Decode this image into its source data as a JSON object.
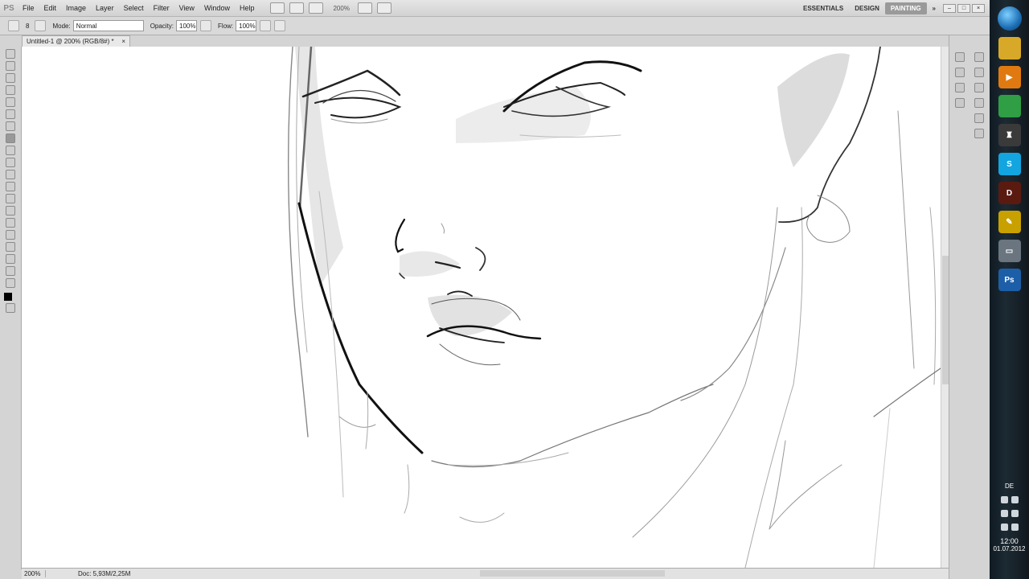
{
  "menubar": {
    "logo": "PS",
    "items": [
      "File",
      "Edit",
      "Image",
      "Layer",
      "Select",
      "Filter",
      "View",
      "Window",
      "Help"
    ],
    "zoom": "200%",
    "workspaces": [
      "ESSENTIALS",
      "DESIGN",
      "PAINTING"
    ],
    "active_workspace": "PAINTING",
    "more": "»"
  },
  "options": {
    "brush_size": "8",
    "mode_label": "Mode:",
    "mode_value": "Normal",
    "opacity_label": "Opacity:",
    "opacity_value": "100%",
    "flow_label": "Flow:",
    "flow_value": "100%"
  },
  "document": {
    "tab_title": "Untitled-1 @ 200% (RGB/8#) *",
    "close": "×"
  },
  "status": {
    "zoom": "200%",
    "doc_info": "Doc: 5,93M/2,25M"
  },
  "taskbar": {
    "language": "DE",
    "time": "12:00",
    "date": "01.07.2012",
    "apps": [
      {
        "name": "explorer",
        "label": "",
        "color": "#d8a928"
      },
      {
        "name": "media-player",
        "label": "▶",
        "color": "#e07a10"
      },
      {
        "name": "chrome",
        "label": "",
        "color": "#2f9e44"
      },
      {
        "name": "world-of-tanks",
        "label": "♜",
        "color": "#3a3a3a"
      },
      {
        "name": "skype",
        "label": "S",
        "color": "#12a5e0"
      },
      {
        "name": "diablo",
        "label": "D",
        "color": "#5a1a10"
      },
      {
        "name": "pen-app",
        "label": "✎",
        "color": "#c8a000"
      },
      {
        "name": "window-app",
        "label": "▭",
        "color": "#6a7580"
      },
      {
        "name": "photoshop",
        "label": "Ps",
        "color": "#1c5fa8"
      }
    ]
  }
}
